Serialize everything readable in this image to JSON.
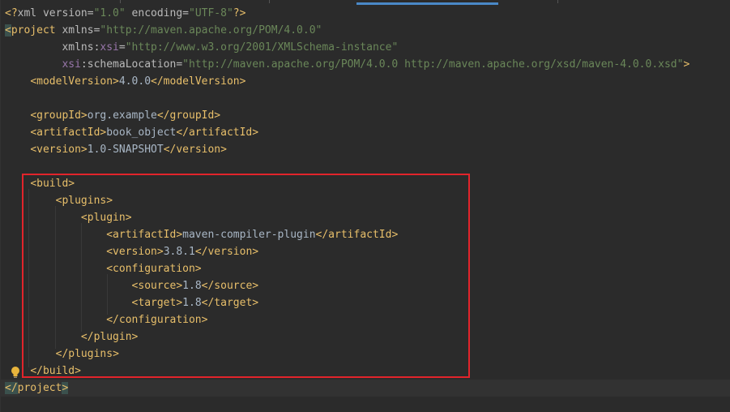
{
  "editor": {
    "lines": [
      {
        "segments": [
          {
            "cls": "pi",
            "text": "<?"
          },
          {
            "cls": "attr",
            "text": "xml version="
          },
          {
            "cls": "val",
            "text": "\"1.0\""
          },
          {
            "cls": "attr",
            "text": " encoding="
          },
          {
            "cls": "val",
            "text": "\"UTF-8\""
          },
          {
            "cls": "pi",
            "text": "?>"
          }
        ]
      },
      {
        "segments": [
          {
            "cls": "tag match",
            "text": "<"
          },
          {
            "cls": "tag",
            "text": "project"
          },
          {
            "cls": "attr",
            "text": " xmlns="
          },
          {
            "cls": "val",
            "text": "\"http://maven.apache.org/POM/4.0.0\""
          }
        ]
      },
      {
        "segments": [
          {
            "cls": "attr",
            "text": "         xmlns:"
          },
          {
            "cls": "ns",
            "text": "xsi"
          },
          {
            "cls": "attr",
            "text": "="
          },
          {
            "cls": "val",
            "text": "\"http://www.w3.org/2001/XMLSchema-instance\""
          }
        ]
      },
      {
        "segments": [
          {
            "cls": "ns",
            "text": "         xsi"
          },
          {
            "cls": "attr",
            "text": ":schemaLocation="
          },
          {
            "cls": "val",
            "text": "\"http://maven.apache.org/POM/4.0.0 http://maven.apache.org/xsd/maven-4.0.0.xsd\""
          },
          {
            "cls": "tag",
            "text": ">"
          }
        ]
      },
      {
        "segments": [
          {
            "cls": "txt",
            "text": "    "
          },
          {
            "cls": "tag",
            "text": "<modelVersion>"
          },
          {
            "cls": "txt",
            "text": "4.0.0"
          },
          {
            "cls": "tag",
            "text": "</modelVersion>"
          }
        ]
      },
      {
        "segments": [
          {
            "cls": "txt",
            "text": ""
          }
        ]
      },
      {
        "segments": [
          {
            "cls": "txt",
            "text": "    "
          },
          {
            "cls": "tag",
            "text": "<groupId>"
          },
          {
            "cls": "txt",
            "text": "org.example"
          },
          {
            "cls": "tag",
            "text": "</groupId>"
          }
        ]
      },
      {
        "segments": [
          {
            "cls": "txt",
            "text": "    "
          },
          {
            "cls": "tag",
            "text": "<artifactId>"
          },
          {
            "cls": "txt",
            "text": "book_object"
          },
          {
            "cls": "tag",
            "text": "</artifactId>"
          }
        ]
      },
      {
        "segments": [
          {
            "cls": "txt",
            "text": "    "
          },
          {
            "cls": "tag",
            "text": "<version>"
          },
          {
            "cls": "txt",
            "text": "1.0-SNAPSHOT"
          },
          {
            "cls": "tag",
            "text": "</version>"
          }
        ]
      },
      {
        "segments": [
          {
            "cls": "txt",
            "text": ""
          }
        ]
      },
      {
        "segments": [
          {
            "cls": "txt",
            "text": "    "
          },
          {
            "cls": "tag",
            "text": "<build>"
          }
        ]
      },
      {
        "segments": [
          {
            "cls": "txt",
            "text": "        "
          },
          {
            "cls": "tag",
            "text": "<plugins>"
          }
        ]
      },
      {
        "segments": [
          {
            "cls": "txt",
            "text": "            "
          },
          {
            "cls": "tag",
            "text": "<plugin>"
          }
        ]
      },
      {
        "segments": [
          {
            "cls": "txt",
            "text": "                "
          },
          {
            "cls": "tag",
            "text": "<artifactId>"
          },
          {
            "cls": "txt",
            "text": "maven-compiler-plugin"
          },
          {
            "cls": "tag",
            "text": "</artifactId>"
          }
        ]
      },
      {
        "segments": [
          {
            "cls": "txt",
            "text": "                "
          },
          {
            "cls": "tag",
            "text": "<version>"
          },
          {
            "cls": "txt",
            "text": "3.8.1"
          },
          {
            "cls": "tag",
            "text": "</version>"
          }
        ]
      },
      {
        "segments": [
          {
            "cls": "txt",
            "text": "                "
          },
          {
            "cls": "tag",
            "text": "<configuration>"
          }
        ]
      },
      {
        "segments": [
          {
            "cls": "txt",
            "text": "                    "
          },
          {
            "cls": "tag",
            "text": "<source>"
          },
          {
            "cls": "txt",
            "text": "1.8"
          },
          {
            "cls": "tag",
            "text": "</source>"
          }
        ]
      },
      {
        "segments": [
          {
            "cls": "txt",
            "text": "                    "
          },
          {
            "cls": "tag",
            "text": "<target>"
          },
          {
            "cls": "txt",
            "text": "1.8"
          },
          {
            "cls": "tag",
            "text": "</target>"
          }
        ]
      },
      {
        "segments": [
          {
            "cls": "txt",
            "text": "                "
          },
          {
            "cls": "tag",
            "text": "</configuration>"
          }
        ]
      },
      {
        "segments": [
          {
            "cls": "txt",
            "text": "            "
          },
          {
            "cls": "tag",
            "text": "</plugin>"
          }
        ]
      },
      {
        "segments": [
          {
            "cls": "txt",
            "text": "        "
          },
          {
            "cls": "tag",
            "text": "</plugins>"
          }
        ]
      },
      {
        "segments": [
          {
            "cls": "txt",
            "text": "    "
          },
          {
            "cls": "tag",
            "text": "</build>"
          }
        ]
      },
      {
        "segments": [
          {
            "cls": "tag match",
            "text": "</"
          },
          {
            "cls": "tag",
            "text": "project"
          },
          {
            "cls": "tag match",
            "text": ">"
          }
        ]
      }
    ],
    "colors": {
      "background": "#2b2b2b",
      "tag": "#e8bf6a",
      "attribute": "#bababa",
      "namespace": "#9876aa",
      "string": "#6a8759",
      "text": "#a9b7c6",
      "highlight_box": "#e2242b",
      "active_tab": "#4a88c7"
    },
    "icons": {
      "intention": "lightbulb-icon"
    }
  }
}
